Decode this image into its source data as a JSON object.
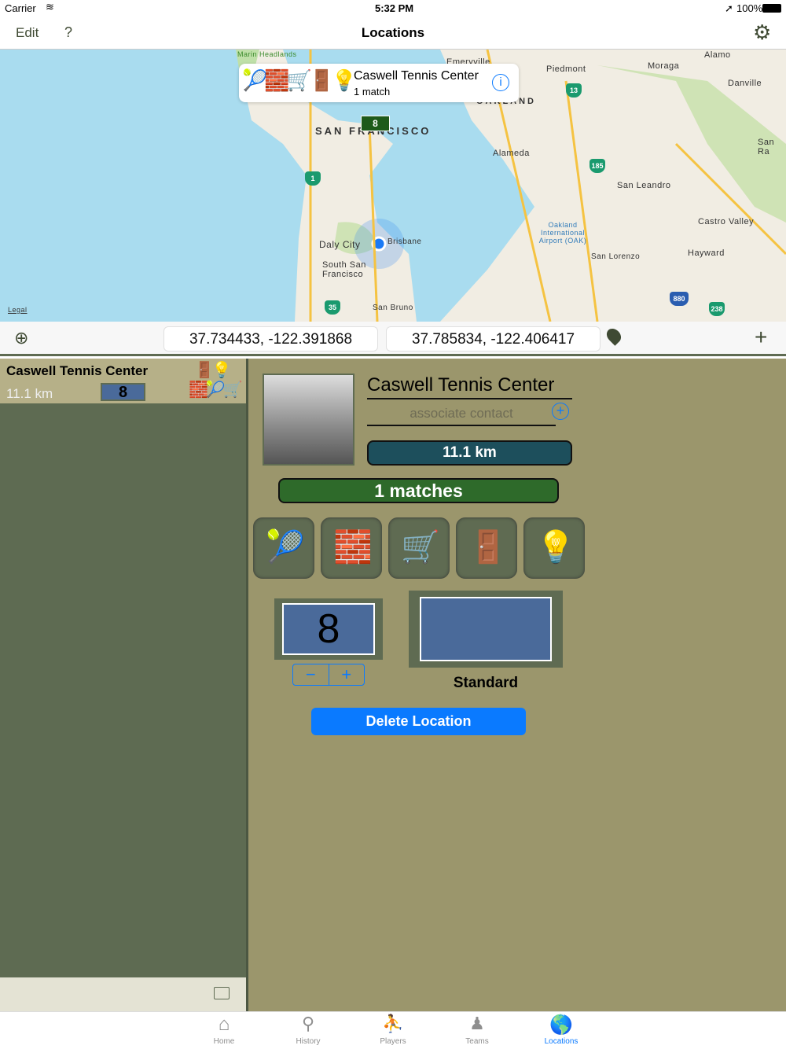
{
  "status_bar": {
    "carrier": "Carrier",
    "time": "5:32 PM",
    "battery": "100%"
  },
  "nav": {
    "edit": "Edit",
    "help": "?",
    "title": "Locations"
  },
  "map": {
    "callout": {
      "title": "Caswell Tennis Center",
      "subtitle": "1 match"
    },
    "cluster_count": "8",
    "labels": [
      "Marin Headlands",
      "Emeryville",
      "Piedmont",
      "Moraga",
      "Alamo",
      "Danville",
      "OAKLAND",
      "SAN FRANCISCO",
      "Alameda",
      "San Ra",
      "San Leandro",
      "Castro Valley",
      "Oakland International Airport (OAK)",
      "Hayward",
      "San Lorenzo",
      "Daly City",
      "Brisbane",
      "South San Francisco",
      "San Bruno"
    ],
    "highways": [
      "13",
      "185",
      "1",
      "35",
      "880",
      "238"
    ],
    "legal": "Legal"
  },
  "coords": {
    "current": "37.734433, -122.391868",
    "selected": "37.785834, -122.406417"
  },
  "list": [
    {
      "name": "Caswell Tennis Center",
      "distance": "11.1 km",
      "courts": "8"
    }
  ],
  "detail": {
    "name": "Caswell Tennis Center",
    "contact_placeholder": "associate contact",
    "distance": "11.1 km",
    "matches": "1 matches",
    "court_count": "8",
    "court_type": "Standard",
    "delete": "Delete Location",
    "amenities": [
      "racquet",
      "wall",
      "ball-cart",
      "restroom",
      "lights"
    ]
  },
  "tabs": [
    {
      "label": "Home"
    },
    {
      "label": "History"
    },
    {
      "label": "Players"
    },
    {
      "label": "Teams"
    },
    {
      "label": "Locations"
    }
  ],
  "colors": {
    "accent": "#0a7aff",
    "distance_bar": "#1d4f5c",
    "matches_bar": "#2e6a2a",
    "delete": "#0a7aff"
  }
}
